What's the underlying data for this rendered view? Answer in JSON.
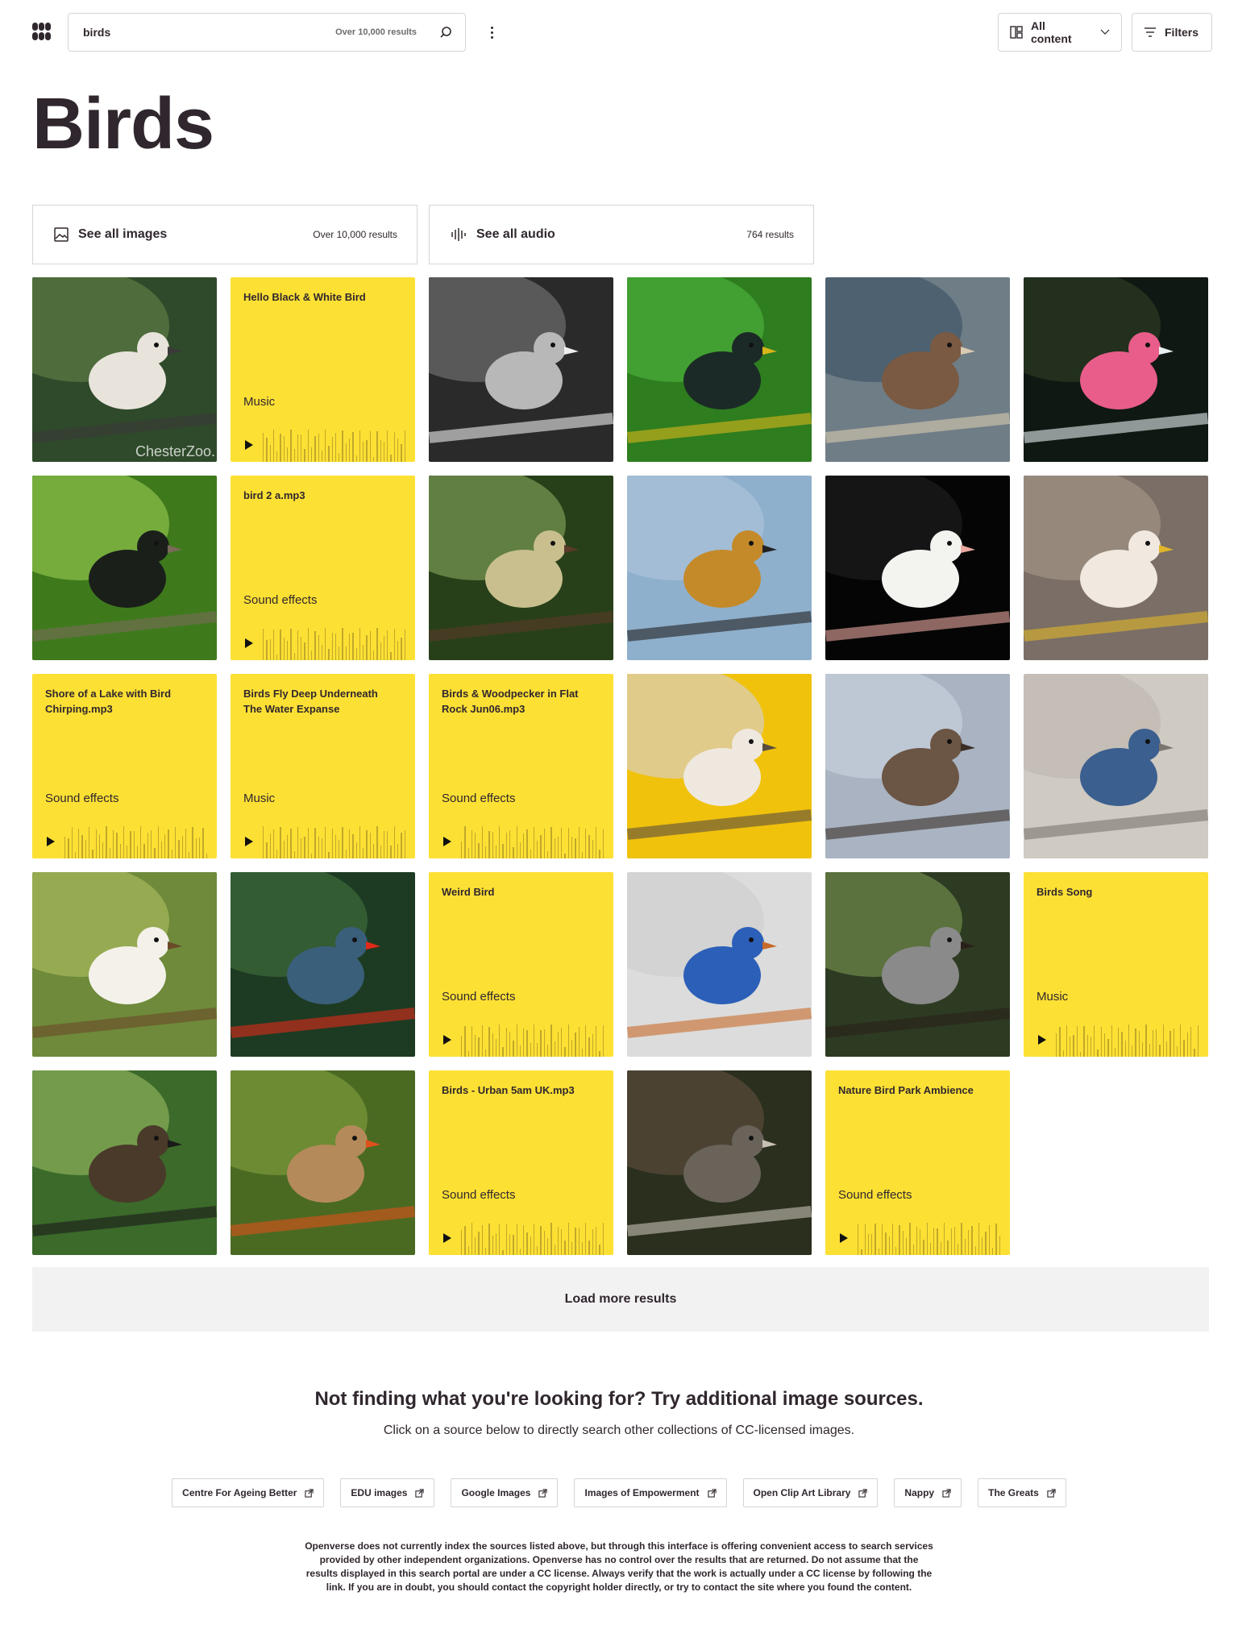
{
  "header": {
    "search_value": "birds",
    "search_count": "Over 10,000 results",
    "content_type": "All content",
    "filters_label": "Filters"
  },
  "page_title": "Birds",
  "see_all": [
    {
      "label": "See all images",
      "count": "Over 10,000 results",
      "icon": "image-icon"
    },
    {
      "label": "See all audio",
      "count": "764 results",
      "icon": "audio-wave-icon"
    }
  ],
  "results": [
    {
      "type": "image",
      "name": "white-dove",
      "watermark": "ChesterZoo."
    },
    {
      "type": "audio",
      "title": "Hello Black & White Bird",
      "genre": "Music"
    },
    {
      "type": "image",
      "name": "sparrows-bw"
    },
    {
      "type": "image",
      "name": "starling-green"
    },
    {
      "type": "image",
      "name": "geese"
    },
    {
      "type": "image",
      "name": "spoonbill"
    },
    {
      "type": "image",
      "name": "starling-dark"
    },
    {
      "type": "audio",
      "title": "bird 2 a.mp3",
      "genre": "Sound effects"
    },
    {
      "type": "image",
      "name": "bird-in-branches"
    },
    {
      "type": "image",
      "name": "bird-on-wire"
    },
    {
      "type": "image",
      "name": "cockatiel"
    },
    {
      "type": "image",
      "name": "falcon"
    },
    {
      "type": "audio",
      "title": "Shore of a Lake with Bird Chirping.mp3",
      "genre": "Sound effects"
    },
    {
      "type": "audio",
      "title": "Birds Fly Deep Underneath The Water Expanse",
      "genre": "Music"
    },
    {
      "type": "audio",
      "title": "Birds & Woodpecker in Flat Rock Jun06.mp3",
      "genre": "Sound effects"
    },
    {
      "type": "image",
      "name": "falcon-closeup"
    },
    {
      "type": "image",
      "name": "bird-on-twig"
    },
    {
      "type": "image",
      "name": "scrub-jay"
    },
    {
      "type": "image",
      "name": "flycatcher"
    },
    {
      "type": "image",
      "name": "hummingbird"
    },
    {
      "type": "audio",
      "title": "Weird Bird",
      "genre": "Sound effects"
    },
    {
      "type": "image",
      "name": "bluebird"
    },
    {
      "type": "image",
      "name": "mockingbird"
    },
    {
      "type": "audio",
      "title": "Birds Song",
      "genre": "Music"
    },
    {
      "type": "image",
      "name": "sicklebill"
    },
    {
      "type": "image",
      "name": "finches"
    },
    {
      "type": "audio",
      "title": "Birds - Urban 5am UK.mp3",
      "genre": "Sound effects"
    },
    {
      "type": "image",
      "name": "ostrich"
    },
    {
      "type": "audio",
      "title": "Nature Bird Park Ambience",
      "genre": "Sound effects"
    }
  ],
  "load_more": "Load more results",
  "not_finding": {
    "title": "Not finding what you're looking for? Try additional image sources.",
    "subtitle": "Click on a source below to directly search other collections of CC-licensed images.",
    "sources": [
      "Centre For Ageing Better",
      "EDU images",
      "Google Images",
      "Images of Empowerment",
      "Open Clip Art Library",
      "Nappy",
      "The Greats"
    ],
    "disclaimer": "Openverse does not currently index the sources listed above, but through this interface is offering convenient access to search services provided by other independent organizations. Openverse has no control over the results that are returned. Do not assume that the results displayed in this search portal are under a CC license. Always verify that the work is actually under a CC license by following the link. If you are in doubt, you should contact the copyright holder directly, or try to contact the site where you found the content."
  },
  "colors": {
    "audio_tile": "#fde034",
    "text": "#30272e",
    "border": "#d8d4d9",
    "load_more_bg": "#f3f2f2"
  }
}
